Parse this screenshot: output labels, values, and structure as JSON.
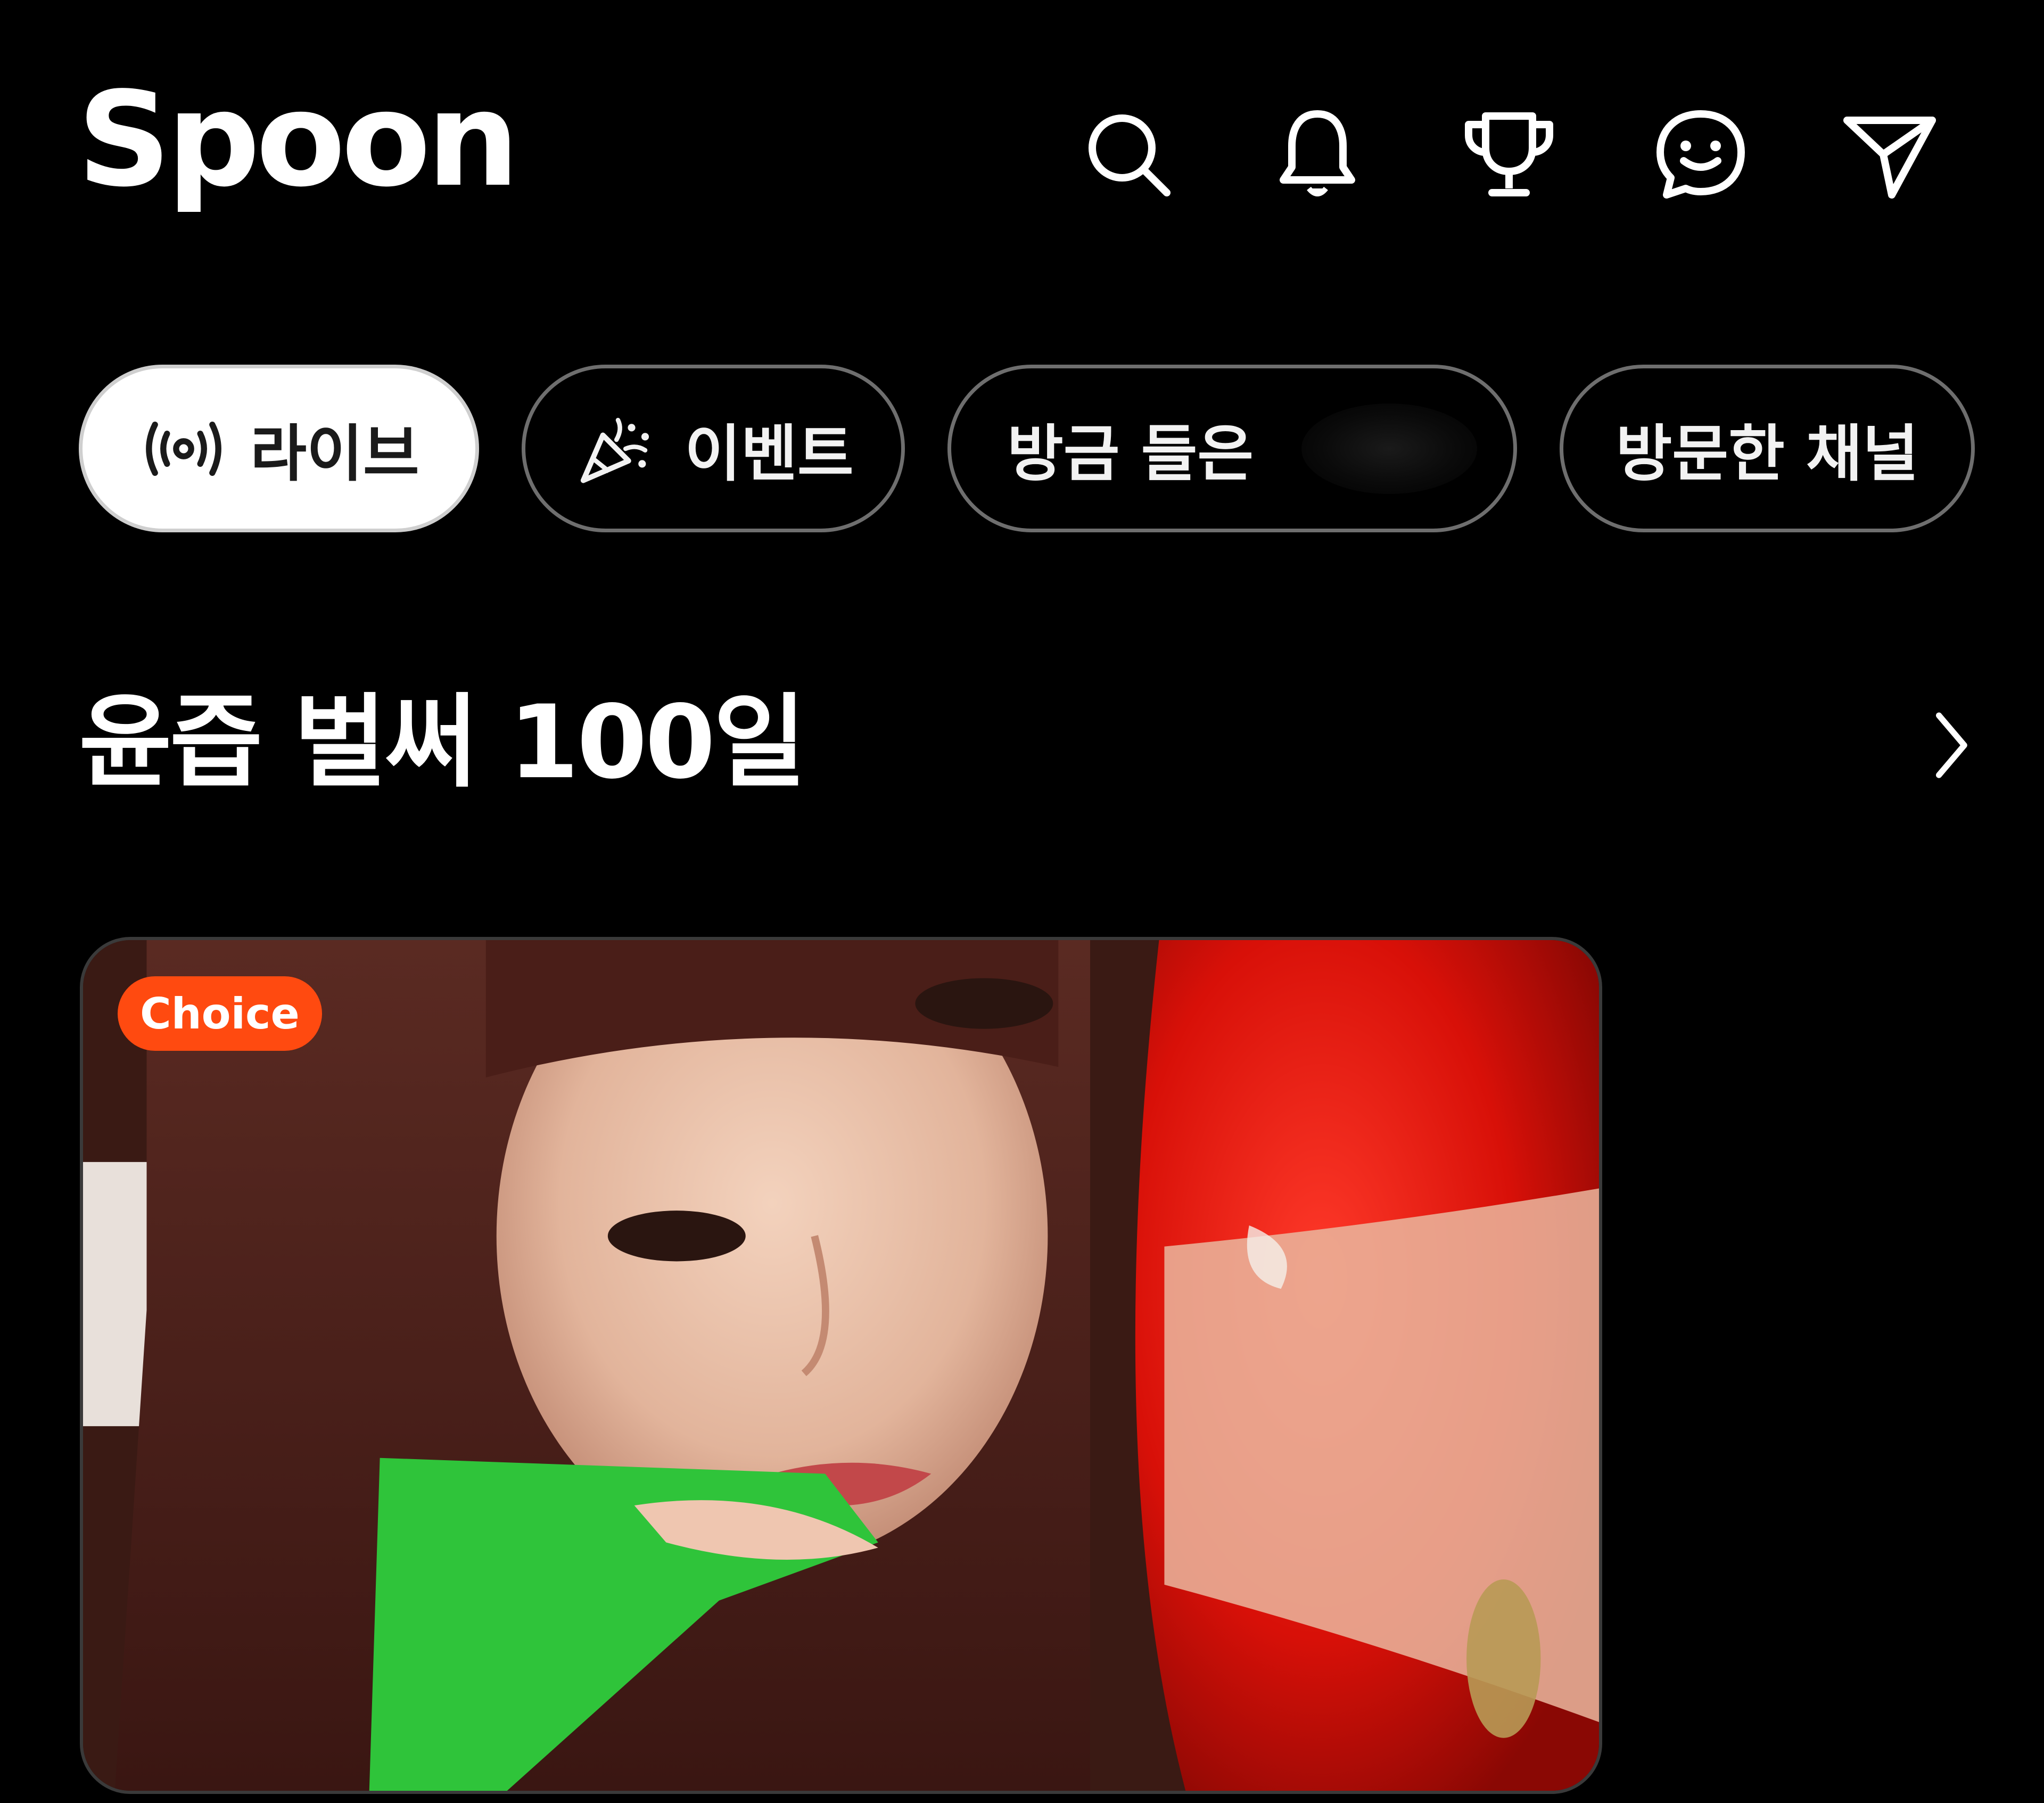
{
  "header": {
    "logo_text": "Spoon",
    "icons": [
      "search-icon",
      "bell-icon",
      "trophy-icon",
      "chat-smile-icon",
      "send-icon"
    ]
  },
  "chips": {
    "live": "라이브",
    "event": "이벤트",
    "recent": "방금 들은",
    "visited": "방문한 채널"
  },
  "section": {
    "title": "윤즙 벌써 100일"
  },
  "card": {
    "badge": "Choice"
  },
  "colors": {
    "background": "#000000",
    "badge": "#ff4a10",
    "active_chip": "#ffffff",
    "chip_border": "#6e6e6e"
  }
}
